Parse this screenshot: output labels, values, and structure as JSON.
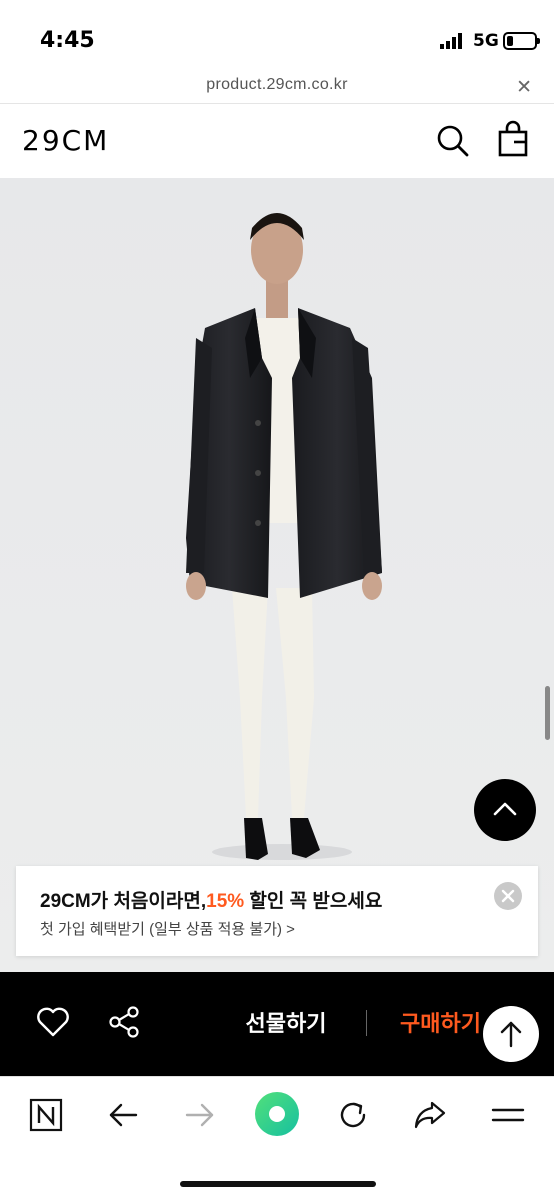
{
  "status_bar": {
    "time": "4:45",
    "network": "5G"
  },
  "browser": {
    "url": "product.29cm.co.kr",
    "close_glyph": "✕"
  },
  "site": {
    "logo": "29CM"
  },
  "header_icons": [
    "search-icon",
    "shopping-bag-icon"
  ],
  "product": {
    "image_alt": "Model wearing black leather jacket with white knit top, white leggings and black flats"
  },
  "promo": {
    "title_prefix": "29CM가 처음이라면,",
    "title_accent": "15%",
    "title_suffix": " 할인 꼭 받으세요",
    "subtitle": "첫 가입 혜택받기 (일부 상품 적용 불가) >"
  },
  "action_bar": {
    "gift_label": "선물하기",
    "buy_label": "구매하기"
  },
  "colors": {
    "accent": "#ff5a1f",
    "action_bar_bg": "#000000",
    "image_bg": "#e9eaec"
  },
  "toolbar_icons": [
    "naver-icon",
    "back-icon",
    "forward-icon",
    "home-dot-icon",
    "refresh-icon",
    "share-icon",
    "menu-icon"
  ]
}
